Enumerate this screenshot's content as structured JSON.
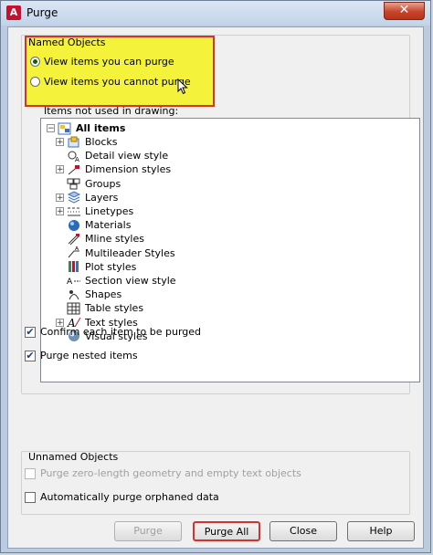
{
  "window": {
    "title": "Purge",
    "close_label": "✕"
  },
  "named_objects": {
    "legend": "Named Objects",
    "radio_purge": "View items you can purge",
    "radio_cannot": "View items you cannot purge",
    "selected": "View items you can purge",
    "tree_label": "Items not used in drawing:"
  },
  "tree": {
    "root": "All items",
    "items": [
      {
        "label": "Blocks",
        "expandable": true,
        "icon": "blocks-icon"
      },
      {
        "label": "Detail view style",
        "expandable": false,
        "icon": "detail-view-icon"
      },
      {
        "label": "Dimension styles",
        "expandable": true,
        "icon": "dimension-icon"
      },
      {
        "label": "Groups",
        "expandable": false,
        "icon": "groups-icon"
      },
      {
        "label": "Layers",
        "expandable": true,
        "icon": "layers-icon"
      },
      {
        "label": "Linetypes",
        "expandable": true,
        "icon": "linetypes-icon"
      },
      {
        "label": "Materials",
        "expandable": false,
        "icon": "materials-icon"
      },
      {
        "label": "Mline styles",
        "expandable": false,
        "icon": "mline-icon"
      },
      {
        "label": "Multileader Styles",
        "expandable": false,
        "icon": "multileader-icon"
      },
      {
        "label": "Plot styles",
        "expandable": false,
        "icon": "plot-icon"
      },
      {
        "label": "Section view style",
        "expandable": false,
        "icon": "section-view-icon"
      },
      {
        "label": "Shapes",
        "expandable": false,
        "icon": "shapes-icon"
      },
      {
        "label": "Table styles",
        "expandable": false,
        "icon": "table-icon"
      },
      {
        "label": "Text styles",
        "expandable": true,
        "icon": "text-icon"
      },
      {
        "label": "Visual styles",
        "expandable": false,
        "icon": "visual-icon"
      }
    ]
  },
  "options": {
    "confirm_each": "Confirm each item to be purged",
    "purge_nested": "Purge nested items"
  },
  "unnamed_objects": {
    "legend": "Unnamed Objects",
    "zero_length": "Purge zero-length geometry and empty text objects",
    "orphaned": "Automatically purge orphaned data"
  },
  "buttons": {
    "purge": "Purge",
    "purge_all": "Purge All",
    "close": "Close",
    "help": "Help"
  },
  "colors": {
    "highlight": "#f4f23a",
    "highlight_border": "#d9302c"
  }
}
